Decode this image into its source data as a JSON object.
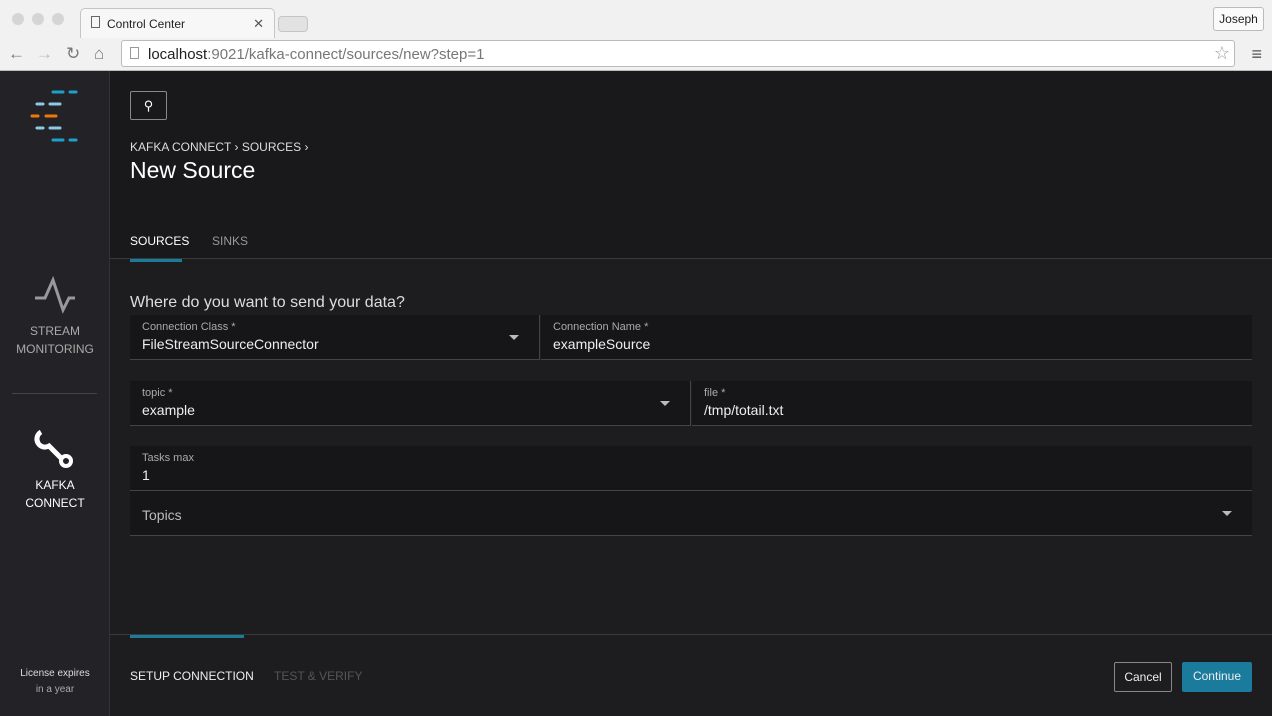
{
  "browser": {
    "tab_title": "Control Center",
    "user": "Joseph",
    "url_host": "localhost",
    "url_rest": ":9021/kafka-connect/sources/new?step=1"
  },
  "sidebar": {
    "items": [
      {
        "label1": "STREAM",
        "label2": "MONITORING"
      },
      {
        "label1": "KAFKA",
        "label2": "CONNECT"
      }
    ],
    "license1": "License expires",
    "license2": "in a year"
  },
  "header": {
    "breadcrumb": [
      "KAFKA CONNECT",
      "SOURCES"
    ],
    "title": "New Source",
    "tabs": [
      "SOURCES",
      "SINKS"
    ]
  },
  "form": {
    "question": "Where do you want to send your data?",
    "fields": [
      {
        "label": "Connection Class *",
        "value": "FileStreamSourceConnector"
      },
      {
        "label": "Connection Name *",
        "value": "exampleSource"
      },
      {
        "label": "topic *",
        "value": "example"
      },
      {
        "label": "file *",
        "value": "/tmp/totail.txt"
      },
      {
        "label": "Tasks max",
        "value": "1"
      },
      {
        "label": "Topics",
        "value": ""
      }
    ]
  },
  "footer": {
    "steps": [
      "SETUP CONNECTION",
      "TEST & VERIFY"
    ],
    "cancel": "Cancel",
    "continue": "Continue"
  },
  "colors": {
    "accent": "#1a7b9c",
    "logo_orange": "#f0780a",
    "logo_blue": "#1ea0c8"
  }
}
